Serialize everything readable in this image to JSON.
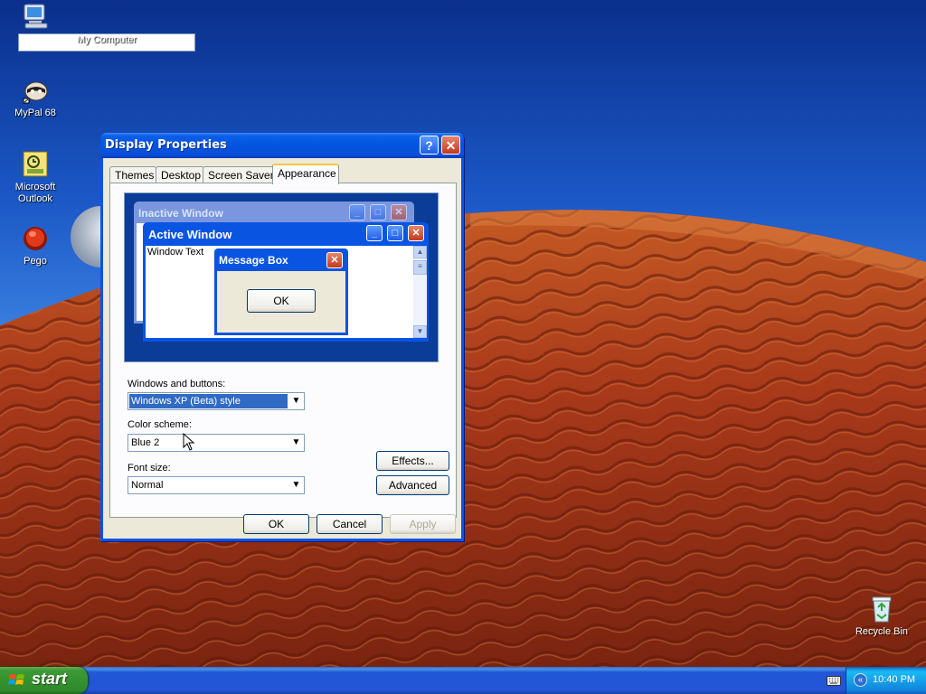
{
  "desktop": {
    "icons": [
      {
        "label": "My Computer",
        "icon": "my-computer-icon"
      },
      {
        "label": "MyPal 68",
        "icon": "mypal-icon"
      },
      {
        "label": "Microsoft Outlook",
        "icon": "outlook-icon"
      },
      {
        "label": "Pego",
        "icon": "pego-icon"
      },
      {
        "label": "Recycle Bin",
        "icon": "recycle-bin-icon"
      }
    ]
  },
  "window": {
    "title": "Display Properties",
    "help_glyph": "?",
    "close_glyph": "✕",
    "tabs": [
      {
        "label": "Themes",
        "active": false
      },
      {
        "label": "Desktop",
        "active": false
      },
      {
        "label": "Screen Saver",
        "active": false
      },
      {
        "label": "Appearance",
        "active": true
      }
    ],
    "preview": {
      "inactive_title": "Inactive Window",
      "active_title": "Active Window",
      "window_text": "Window Text",
      "message_box_title": "Message Box",
      "message_box_ok": "OK"
    },
    "fields": {
      "windows_buttons_label": "Windows and buttons:",
      "windows_buttons_value": "Windows XP (Beta) style",
      "color_scheme_label": "Color scheme:",
      "color_scheme_value": "Blue 2",
      "font_size_label": "Font size:",
      "font_size_value": "Normal"
    },
    "buttons": {
      "effects": "Effects...",
      "advanced": "Advanced",
      "ok": "OK",
      "cancel": "Cancel",
      "apply": "Apply"
    }
  },
  "taskbar": {
    "start_label": "start",
    "clock": "10:40 PM",
    "tray_chevron": "«"
  },
  "colors": {
    "titlebar": "#0a54e2",
    "dialog_face": "#ece9d8",
    "tab_highlight": "#ffc73c",
    "start_green": "#3c9a36",
    "selection": "#316ac5"
  }
}
